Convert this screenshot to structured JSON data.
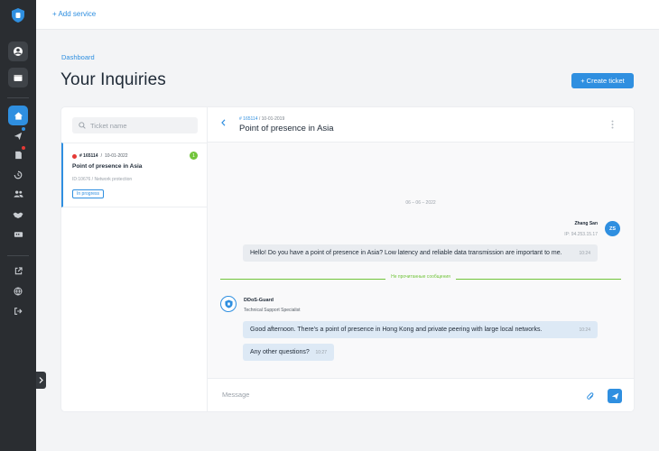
{
  "topbar": {
    "add_service": "+ Add service"
  },
  "breadcrumb": "Dashboard",
  "page_title": "Your Inquiries",
  "create_ticket": "+ Create ticket",
  "search": {
    "placeholder": "Ticket name"
  },
  "ticket": {
    "id": "# 165114",
    "sep": "/",
    "date": "10-01-2022",
    "unread_count": "1",
    "title": "Point of presence in Asia",
    "sub": "ID:10676 / Network protection",
    "status": "In progress"
  },
  "chat": {
    "header_id": "# 165114",
    "header_sep": "/",
    "header_date": "10-01-2019",
    "title": "Point of presence in Asia",
    "date_separator": "06 – 06 – 2022",
    "user": {
      "name": "Zhang San",
      "ip": "IP: 94.253.15.17",
      "initials": "ZS",
      "message": "Hello! Do you have a point of presence in Asia? Low latency and reliable data transmission are important to me.",
      "time": "10:24"
    },
    "unread_label": "Не прочитанные сообщения",
    "agent": {
      "name": "DDoS-Guard",
      "role": "Technical Support Specialist",
      "messages": [
        {
          "text": "Good afternoon. There's a point of presence in Hong Kong and private peering with large local networks.",
          "time": "10:24"
        },
        {
          "text": "Any other questions?",
          "time": "10:27"
        }
      ]
    },
    "composer_placeholder": "Message"
  },
  "colors": {
    "accent": "#2f8fe0",
    "sidebar": "#2a2d31",
    "green": "#71c43a",
    "red": "#e53935"
  },
  "icons": [
    "shield-logo-icon",
    "user-icon",
    "wallet-icon",
    "home-icon",
    "send-icon",
    "document-icon",
    "history-icon",
    "users-icon",
    "handshake-icon",
    "server-icon",
    "external-link-icon",
    "globe-icon",
    "logout-icon",
    "chevron-right-icon",
    "search-icon",
    "chevron-left-icon",
    "kebab-icon",
    "paperclip-icon"
  ]
}
